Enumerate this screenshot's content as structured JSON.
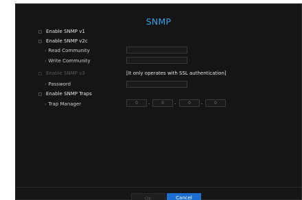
{
  "dialog": {
    "title": "SNMP"
  },
  "options": {
    "v1_label": "Enable SNMP v1",
    "v2c_label": "Enable SNMP v2c",
    "read_community_label": "Read Community",
    "write_community_label": "Write Community",
    "v3_label": "Enable SNMP v3",
    "ssl_note": "[It only operates with SSL authentication]",
    "password_label": "Password",
    "traps_label": "Enable SNMP Traps",
    "trap_manager_label": "Trap Manager"
  },
  "trap_manager": {
    "octets": [
      "0",
      "0",
      "0",
      "0"
    ],
    "separator": "."
  },
  "footer": {
    "ok_label": "OK",
    "cancel_label": "Cancel"
  },
  "colors": {
    "background": "#151515",
    "accent": "#3aa1e6",
    "primary_button": "#1c6fd0",
    "disabled_text": "#5a5a5a"
  }
}
